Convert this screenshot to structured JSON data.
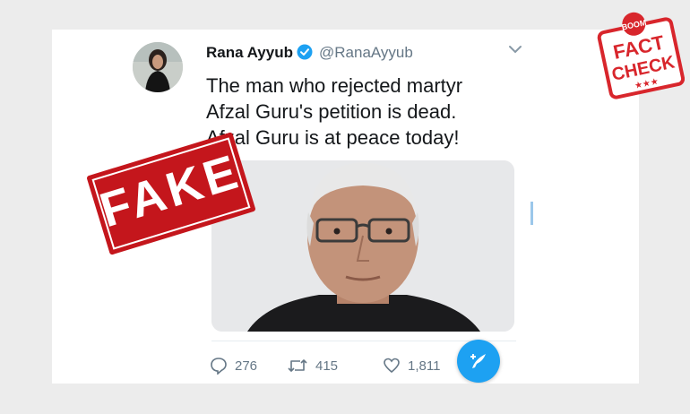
{
  "tweet": {
    "display_name": "Rana Ayyub",
    "handle": "@RanaAyyub",
    "text_lines": [
      "The man who rejected martyr",
      "Afzal Guru's petition is dead.",
      "Afzal Guru is at peace today!"
    ],
    "replies": "276",
    "retweets": "415",
    "likes": "1,811"
  },
  "stamp": {
    "text": "FAKE",
    "color": "#c4161c"
  },
  "logo": {
    "top": "BOOM",
    "line1": "FACT",
    "line2": "CHECK",
    "stars": "★★★",
    "color": "#d8262c"
  },
  "colors": {
    "accent": "#1da1f2",
    "text": "#14171a",
    "muted": "#657786"
  },
  "icons": {
    "verified": "verified-badge-icon",
    "more": "chevron-down-icon",
    "reply": "reply-icon",
    "retweet": "retweet-icon",
    "like": "heart-icon",
    "compose": "compose-tweet-icon"
  }
}
